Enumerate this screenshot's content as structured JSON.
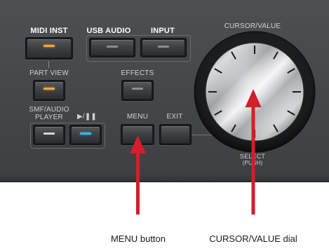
{
  "panel": {
    "labels": {
      "midi_inst": "MIDI INST",
      "usb_audio": "USB AUDIO",
      "input": "INPUT",
      "cursor_value": "CURSOR/VALUE",
      "part_view": "PART VIEW",
      "effects": "EFFECTS",
      "smf_audio_player_line1": "SMF/AUDIO",
      "smf_audio_player_line2": "PLAYER",
      "play_pause": "▶/❚❚",
      "menu": "MENU",
      "exit": "EXIT",
      "select": "SELECT",
      "push": "(PUSH)"
    },
    "led_colors": {
      "midi_inst": "#f3a53b",
      "usb_audio": "#8a8c8f",
      "input": "#8a8c8f",
      "part_view": "#f3a53b",
      "effects": "#8a8c8f",
      "smf_audio_player": "#d8d8d8",
      "play_pause": "#3cb6e8",
      "menu": "#8a8c8f",
      "exit": "#8a8c8f"
    },
    "dial": {
      "icon": "cursor-value-dial-icon",
      "tick_count": 12
    }
  },
  "annotations": {
    "arrow_color": "#d21f2b",
    "menu_caption": "MENU button",
    "dial_caption": "CURSOR/VALUE dial"
  }
}
